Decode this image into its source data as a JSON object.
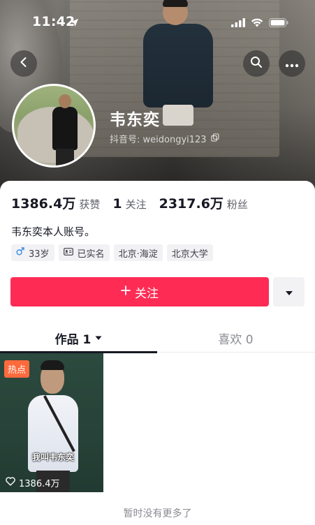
{
  "status_bar": {
    "time": "11:42"
  },
  "profile": {
    "name": "韦东奕",
    "douyin_id": "抖音号: weidongyi123",
    "bio": "韦东奕本人账号。"
  },
  "stats": [
    {
      "value": "1386.4万",
      "label": "获赞"
    },
    {
      "value": "1",
      "label": "关注"
    },
    {
      "value": "2317.6万",
      "label": "粉丝"
    }
  ],
  "tags": {
    "age": "33岁",
    "verified": "已实名",
    "location": "北京·海淀",
    "school": "北京大学"
  },
  "follow_button": {
    "label": "关注"
  },
  "tabs": {
    "works": "作品 1",
    "likes": "喜欢 0"
  },
  "video": {
    "badge": "热点",
    "caption": "我叫韦东奕",
    "likes": "1386.4万"
  },
  "footer": {
    "no_more": "暂时没有更多了"
  },
  "colors": {
    "accent": "#fe2c55",
    "hot_badge": "#fe6a3c"
  }
}
